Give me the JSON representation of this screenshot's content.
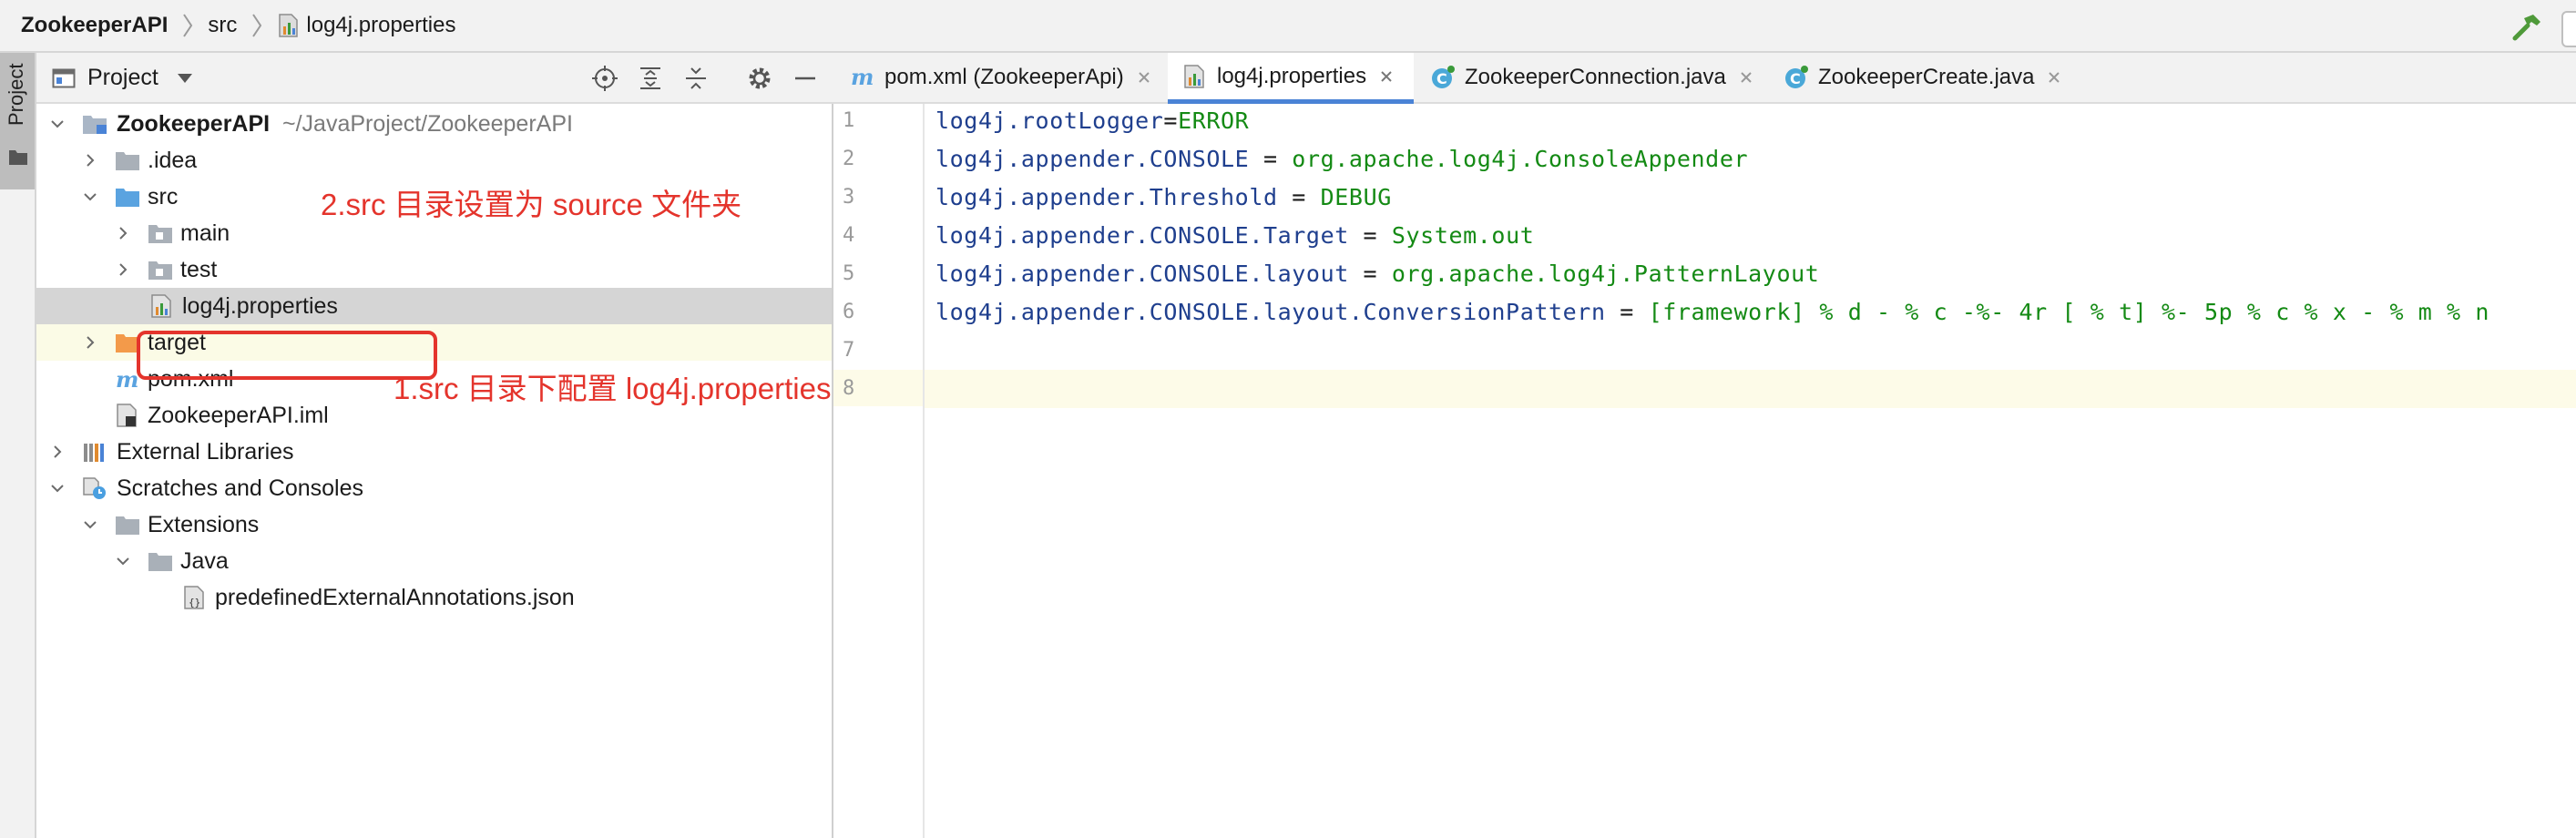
{
  "breadcrumb": {
    "project": "ZookeeperAPI",
    "folder": "src",
    "file": "log4j.properties"
  },
  "stripe": {
    "label": "Project"
  },
  "project_panel": {
    "title": "Project",
    "tree": [
      {
        "label": "ZookeeperAPI",
        "path": "~/JavaProject/ZookeeperAPI",
        "icon": "module-folder-icon",
        "expanded": true
      },
      {
        "label": ".idea",
        "icon": "folder-icon",
        "expanded": false
      },
      {
        "label": "src",
        "icon": "source-folder-icon",
        "expanded": true
      },
      {
        "label": "main",
        "icon": "folder-icon",
        "expanded": false
      },
      {
        "label": "test",
        "icon": "folder-icon",
        "expanded": false
      },
      {
        "label": "log4j.properties",
        "icon": "properties-file-icon"
      },
      {
        "label": "target",
        "icon": "excluded-folder-icon",
        "expanded": false
      },
      {
        "label": "pom.xml",
        "icon": "maven-icon"
      },
      {
        "label": "ZookeeperAPI.iml",
        "icon": "iml-file-icon"
      },
      {
        "label": "External Libraries",
        "icon": "libraries-icon",
        "expanded": false
      },
      {
        "label": "Scratches and Consoles",
        "icon": "scratches-icon",
        "expanded": true
      },
      {
        "label": "Extensions",
        "icon": "folder-icon",
        "expanded": true
      },
      {
        "label": "Java",
        "icon": "folder-icon",
        "expanded": true
      },
      {
        "label": "predefinedExternalAnnotations.json",
        "icon": "json-file-icon"
      }
    ]
  },
  "annotations": {
    "src_source": "2.src 目录设置为 source 文件夹",
    "log4j_config": "1.src 目录下配置 log4j.properties"
  },
  "tabs": [
    {
      "label": "pom.xml (ZookeeperApi)",
      "icon": "maven-icon",
      "active": false
    },
    {
      "label": "log4j.properties",
      "icon": "properties-file-icon",
      "active": true
    },
    {
      "label": "ZookeeperConnection.java",
      "icon": "java-class-icon",
      "active": false
    },
    {
      "label": "ZookeeperCreate.java",
      "icon": "java-class-icon",
      "active": false
    }
  ],
  "editor": {
    "line_numbers": [
      "1",
      "2",
      "3",
      "4",
      "5",
      "6",
      "7",
      "8"
    ],
    "lines": [
      {
        "key": "log4j.rootLogger",
        "op": "=",
        "value": "ERROR"
      },
      {
        "key": "log4j.appender.CONSOLE",
        "op": " = ",
        "value": "org.apache.log4j.ConsoleAppender"
      },
      {
        "key": "log4j.appender.Threshold",
        "op": " = ",
        "value": "DEBUG"
      },
      {
        "key": "log4j.appender.CONSOLE.Target",
        "op": " = ",
        "value": "System.out"
      },
      {
        "key": "log4j.appender.CONSOLE.layout",
        "op": " = ",
        "value": "org.apache.log4j.PatternLayout"
      },
      {
        "key": "log4j.appender.CONSOLE.layout.ConversionPattern",
        "op": " = ",
        "value": "[framework] % d - % c -%- 4r [ % t] %- 5p % c % x - % m % n"
      }
    ]
  },
  "colors": {
    "key": "#1f3f8e",
    "value": "#148a14",
    "annotation": "#e4342c",
    "active_tab_underline": "#4a83d6"
  }
}
